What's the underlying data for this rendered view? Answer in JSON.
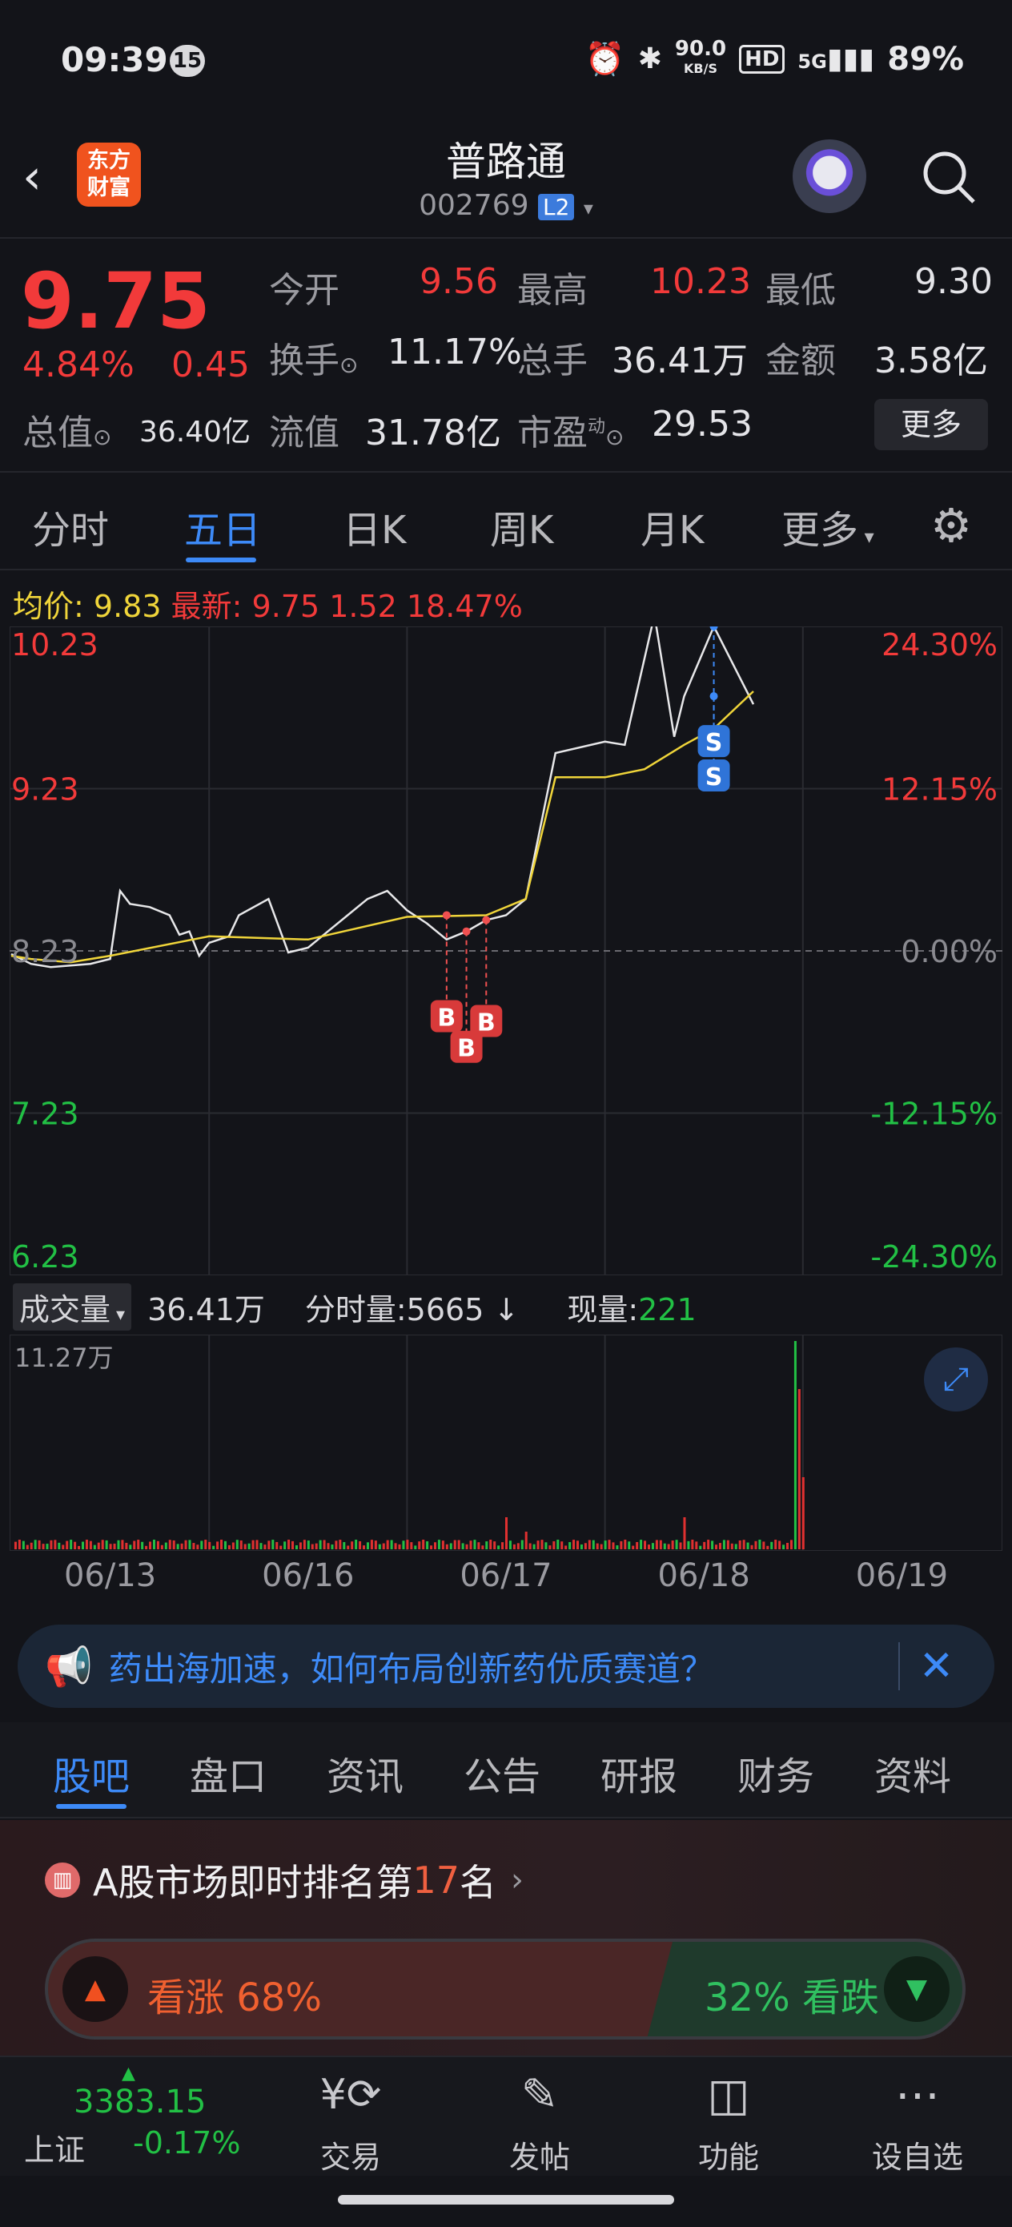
{
  "status_bar": {
    "time": "09:39",
    "badge": "15",
    "speed": "90.0",
    "speed_unit": "KB/S",
    "hd": "HD",
    "network": "5G",
    "battery": "89%"
  },
  "header": {
    "logo_top": "东方",
    "logo_bottom": "财富",
    "title": "普路通",
    "code": "002769",
    "level": "L2"
  },
  "quote": {
    "price": "9.75",
    "change_pct": "4.84%",
    "change": "0.45",
    "open_label": "今开",
    "open": "9.56",
    "high_label": "最高",
    "high": "10.23",
    "low_label": "最低",
    "low": "9.30",
    "turnover_label": "换手",
    "turnover": "11.17%",
    "volume_label": "总手",
    "volume": "36.41万",
    "amount_label": "金额",
    "amount": "3.58亿",
    "mktcap_label": "总值",
    "mktcap": "36.40亿",
    "float_label": "流值",
    "float": "31.78亿",
    "pe_label": "市盈",
    "pe_sup": "动",
    "pe": "29.53",
    "more": "更多"
  },
  "chart_tabs": [
    "分时",
    "五日",
    "日K",
    "周K",
    "月K",
    "更多"
  ],
  "active_tab": "五日",
  "chart_info": {
    "avg_label": "均价:",
    "avg": "9.83",
    "latest_label": "最新:",
    "latest": "9.75",
    "chg": "1.52",
    "chg_pct": "18.47%"
  },
  "chart_data": {
    "type": "line",
    "x_labels": [
      "06/13",
      "06/16",
      "06/17",
      "06/18",
      "06/19"
    ],
    "y_left": [
      "10.23",
      "9.23",
      "8.23",
      "7.23",
      "6.23"
    ],
    "y_right": [
      "24.30%",
      "12.15%",
      "0.00%",
      "-12.15%",
      "-24.30%"
    ],
    "ylim": [
      6.23,
      10.23
    ],
    "series": [
      {
        "name": "最新",
        "color": "#e8e8ea",
        "points": [
          [
            0,
            8.21
          ],
          [
            0.1,
            8.15
          ],
          [
            0.2,
            8.13
          ],
          [
            0.3,
            8.14
          ],
          [
            0.4,
            8.15
          ],
          [
            0.5,
            8.18
          ],
          [
            0.55,
            8.6
          ],
          [
            0.6,
            8.52
          ],
          [
            0.7,
            8.5
          ],
          [
            0.8,
            8.45
          ],
          [
            0.85,
            8.33
          ],
          [
            0.9,
            8.35
          ],
          [
            0.95,
            8.2
          ],
          [
            1.0,
            8.28
          ],
          [
            1.1,
            8.32
          ],
          [
            1.15,
            8.45
          ],
          [
            1.3,
            8.55
          ],
          [
            1.4,
            8.22
          ],
          [
            1.5,
            8.25
          ],
          [
            1.6,
            8.35
          ],
          [
            1.7,
            8.45
          ],
          [
            1.8,
            8.55
          ],
          [
            1.9,
            8.6
          ],
          [
            2.0,
            8.48
          ],
          [
            2.1,
            8.4
          ],
          [
            2.2,
            8.3
          ],
          [
            2.3,
            8.35
          ],
          [
            2.4,
            8.42
          ],
          [
            2.5,
            8.45
          ],
          [
            2.55,
            8.5
          ],
          [
            2.6,
            8.55
          ],
          [
            2.75,
            9.45
          ],
          [
            3.0,
            9.52
          ],
          [
            3.1,
            9.5
          ],
          [
            3.25,
            10.3
          ],
          [
            3.35,
            9.55
          ],
          [
            3.4,
            9.8
          ],
          [
            3.55,
            10.23
          ],
          [
            3.75,
            9.75
          ]
        ]
      },
      {
        "name": "均价",
        "color": "#f0d53a",
        "points": [
          [
            0,
            8.2
          ],
          [
            0.1,
            8.18
          ],
          [
            0.3,
            8.16
          ],
          [
            0.5,
            8.2
          ],
          [
            1.0,
            8.32
          ],
          [
            1.5,
            8.3
          ],
          [
            2.0,
            8.44
          ],
          [
            2.4,
            8.45
          ],
          [
            2.6,
            8.55
          ],
          [
            2.75,
            9.3
          ],
          [
            3.0,
            9.3
          ],
          [
            3.2,
            9.35
          ],
          [
            3.4,
            9.5
          ],
          [
            3.55,
            9.6
          ],
          [
            3.75,
            9.83
          ]
        ]
      }
    ],
    "markers": [
      {
        "label": "B",
        "x": 2.2,
        "y": 8.45
      },
      {
        "label": "B",
        "x": 2.3,
        "y": 8.35
      },
      {
        "label": "B",
        "x": 2.4,
        "y": 8.42
      },
      {
        "label": "S",
        "x": 3.55,
        "y": 10.23
      },
      {
        "label": "S",
        "x": 3.55,
        "y": 9.8
      }
    ]
  },
  "volume": {
    "label": "成交量",
    "total": "36.41万",
    "per_label": "分时量:",
    "per": "5665",
    "now_label": "现量:",
    "now": "221",
    "max": "11.27万"
  },
  "banner": {
    "text": "药出海加速，如何布局创新药优质赛道？"
  },
  "section_tabs": [
    "股吧",
    "盘口",
    "资讯",
    "公告",
    "研报",
    "财务",
    "资料"
  ],
  "active_section": "股吧",
  "rank": {
    "prefix": "A股市场即时排名第",
    "num": "17",
    "suffix": "名"
  },
  "sentiment": {
    "up_label": "看涨",
    "up_pct": "68%",
    "down_label": "看跌",
    "down_pct": "32%"
  },
  "bottom": {
    "index": "3383.15",
    "index_name": "上证",
    "index_chg": "-0.17%",
    "items": [
      "交易",
      "发帖",
      "功能",
      "设自选"
    ]
  }
}
